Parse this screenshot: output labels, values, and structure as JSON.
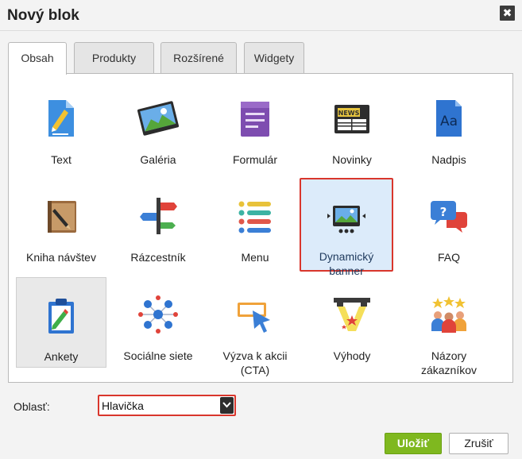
{
  "dialog": {
    "title": "Nový blok",
    "close_symbol": "✖"
  },
  "tabs": [
    {
      "label": "Obsah",
      "active": true
    },
    {
      "label": "Produkty",
      "active": false
    },
    {
      "label": "Rozšírené",
      "active": false
    },
    {
      "label": "Widgety",
      "active": false
    }
  ],
  "blocks": [
    {
      "label": "Text",
      "icon": "text-document-icon"
    },
    {
      "label": "Galéria",
      "icon": "gallery-icon"
    },
    {
      "label": "Formulár",
      "icon": "form-icon"
    },
    {
      "label": "Novinky",
      "icon": "news-icon",
      "icon_text": "NEWS"
    },
    {
      "label": "Nadpis",
      "icon": "heading-icon",
      "icon_text": "Aa"
    },
    {
      "label": "Kniha návštev",
      "icon": "guestbook-icon"
    },
    {
      "label": "Rázcestník",
      "icon": "signpost-icon"
    },
    {
      "label": "Menu",
      "icon": "menu-list-icon"
    },
    {
      "label": "Dynamický banner",
      "icon": "dynamic-banner-icon",
      "selected": true
    },
    {
      "label": "FAQ",
      "icon": "faq-icon",
      "icon_text": "?"
    },
    {
      "label": "Ankety",
      "icon": "poll-icon",
      "hovered": true
    },
    {
      "label": "Sociálne siete",
      "icon": "social-network-icon"
    },
    {
      "label": "Výzva k akcii (CTA)",
      "icon": "call-to-action-icon"
    },
    {
      "label": "Výhody",
      "icon": "benefits-icon"
    },
    {
      "label": "Názory zákazníkov",
      "icon": "customer-reviews-icon"
    }
  ],
  "area": {
    "label": "Oblasť:",
    "selected": "Hlavička"
  },
  "actions": {
    "save_label": "Uložiť",
    "cancel_label": "Zrušiť"
  },
  "colors": {
    "accent_red": "#d9362c",
    "save_green": "#7fb81f",
    "selected_bg": "#dcebfa"
  }
}
